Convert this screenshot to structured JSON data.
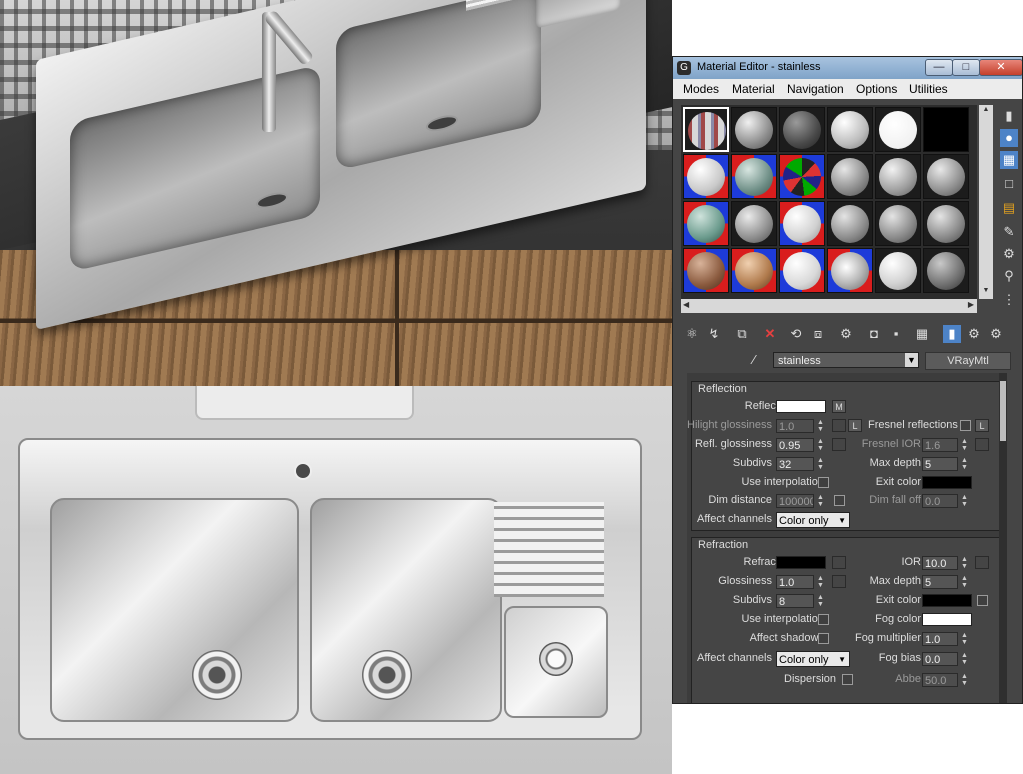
{
  "window": {
    "title": "Material Editor - stainless",
    "min_glyph": "—",
    "max_glyph": "□",
    "close_glyph": "✕"
  },
  "menu": [
    "Modes",
    "Material",
    "Navigation",
    "Options",
    "Utilities"
  ],
  "material": {
    "name": "stainless",
    "type": "VRayMtl"
  },
  "reflection": {
    "section": "Reflection",
    "reflect_label": "Reflect",
    "reflect_color": "#ffffff",
    "map_button": "M",
    "hilight_glossiness_label": "Hilight glossiness",
    "hilight_glossiness": "1.0",
    "lock_button": "L",
    "fresnel_label": "Fresnel reflections",
    "fresnel_lock": "L",
    "refl_glossiness_label": "Refl. glossiness",
    "refl_glossiness": "0.95",
    "fresnel_ior_label": "Fresnel IOR",
    "fresnel_ior": "1.6",
    "subdivs_label": "Subdivs",
    "subdivs": "32",
    "max_depth_label": "Max depth",
    "max_depth": "5",
    "use_interpolation_label": "Use interpolation",
    "exit_color_label": "Exit color",
    "exit_color": "#000000",
    "dim_distance_label": "Dim distance",
    "dim_distance": "100000",
    "dim_fall_off_label": "Dim fall off",
    "dim_fall_off": "0.0",
    "affect_channels_label": "Affect channels",
    "affect_channels": "Color only"
  },
  "refraction": {
    "section": "Refraction",
    "refract_label": "Refract",
    "refract_color": "#000000",
    "ior_label": "IOR",
    "ior": "10.0",
    "glossiness_label": "Glossiness",
    "glossiness": "1.0",
    "max_depth_label": "Max depth",
    "max_depth": "5",
    "subdivs_label": "Subdivs",
    "subdivs": "8",
    "exit_color_label": "Exit color",
    "exit_color": "#000000",
    "use_interpolation_label": "Use interpolation",
    "fog_color_label": "Fog color",
    "fog_color": "#ffffff",
    "affect_shadows_label": "Affect shadows",
    "fog_multiplier_label": "Fog multiplier",
    "fog_multiplier": "1.0",
    "affect_channels_label": "Affect channels",
    "affect_channels": "Color only",
    "fog_bias_label": "Fog bias",
    "fog_bias": "0.0",
    "dispersion_label": "Dispersion",
    "abbe_label": "Abbe",
    "abbe": "50.0"
  }
}
